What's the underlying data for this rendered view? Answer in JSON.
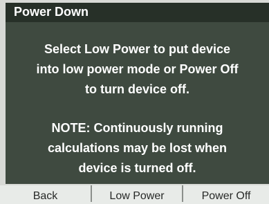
{
  "dialog": {
    "title": "Power Down",
    "message_lines": [
      "Select Low Power to put device",
      "into low power mode or Power Off",
      "to turn device off."
    ],
    "note_lines": [
      "NOTE: Continuously running",
      "calculations may be lost when",
      "device is turned off."
    ]
  },
  "softkeys": {
    "back": "Back",
    "low_power": "Low Power",
    "power_off": "Power Off"
  },
  "colors": {
    "screen_background": "#3f4a40",
    "title_bar": "#273028",
    "text": "#ffffff",
    "softkey_bar": "#e8ebe8"
  }
}
